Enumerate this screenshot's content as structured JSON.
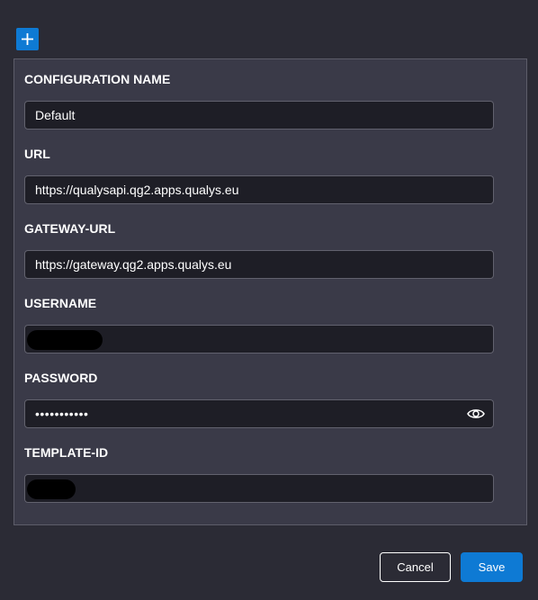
{
  "form": {
    "fields": [
      {
        "label": "CONFIGURATION NAME",
        "value": "Default"
      },
      {
        "label": "URL",
        "value": "https://qualysapi.qg2.apps.qualys.eu"
      },
      {
        "label": "GATEWAY-URL",
        "value": "https://gateway.qg2.apps.qualys.eu"
      },
      {
        "label": "USERNAME",
        "value": ""
      },
      {
        "label": "PASSWORD",
        "value": "•••••••••••"
      },
      {
        "label": "TEMPLATE-ID",
        "value": ""
      }
    ]
  },
  "actions": {
    "cancel_label": "Cancel",
    "save_label": "Save"
  },
  "icons": {
    "add": "plus-icon",
    "reveal_password": "eye-icon"
  },
  "colors": {
    "accent": "#0e7ad4",
    "panel": "#3a3a48",
    "input_bg": "#1e1e26"
  }
}
